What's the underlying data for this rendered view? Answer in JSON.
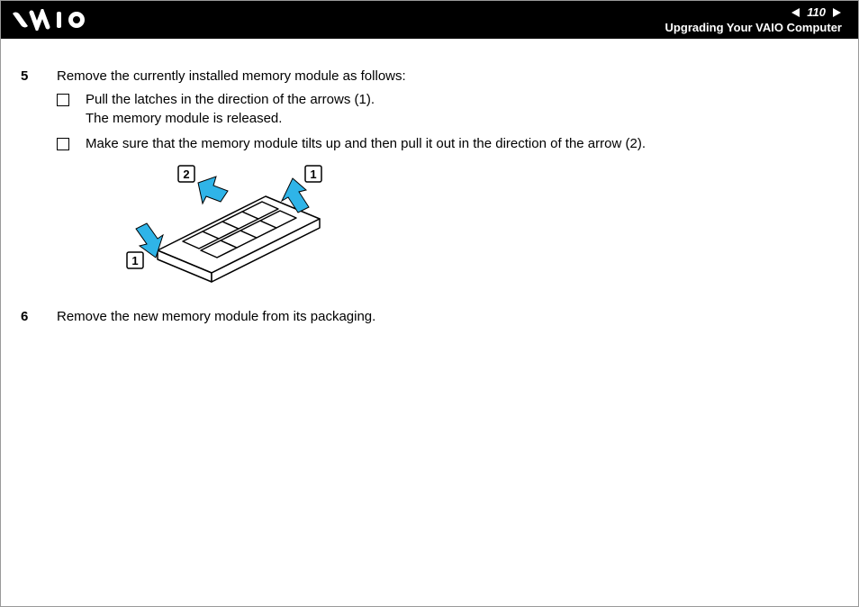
{
  "header": {
    "page_number": "110",
    "section_title": "Upgrading Your VAIO Computer",
    "logo_alt": "VAIO"
  },
  "steps": [
    {
      "number": "5",
      "text": "Remove the currently installed memory module as follows:",
      "bullets": [
        "Pull the latches in the direction of the arrows (1).\nThe memory module is released.",
        "Make sure that the memory module tilts up and then pull it out in the direction of the arrow (2)."
      ]
    },
    {
      "number": "6",
      "text": "Remove the new memory module from its packaging."
    }
  ],
  "figure": {
    "labels": [
      "2",
      "1",
      "1"
    ],
    "description": "memory module with two arrows labeled 1 pointing outward at the latches and one arrow labeled 2 pointing up and away"
  }
}
